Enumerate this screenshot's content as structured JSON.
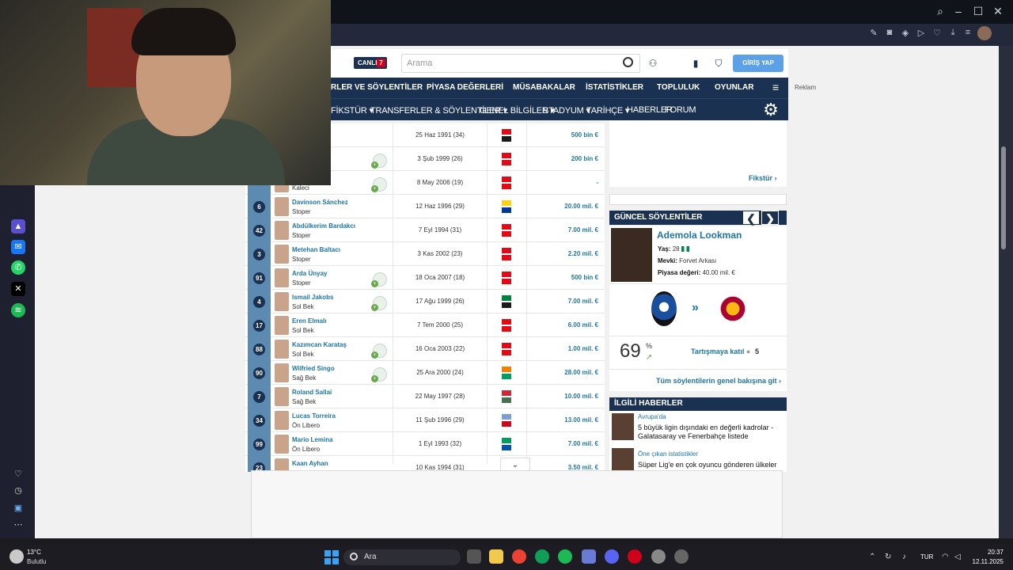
{
  "browser": {
    "window_controls": [
      "search",
      "minimize",
      "maximize",
      "close"
    ],
    "toolbar_icons": [
      "edit-icon",
      "camera-icon",
      "shield-check-icon",
      "play-icon",
      "heart-icon",
      "download-icon",
      "menu-icon"
    ]
  },
  "header": {
    "live_label": "CANLI",
    "live_count": "7",
    "search_placeholder": "Arama",
    "login_label": "GİRİŞ YAP",
    "ad_label": "Reklam"
  },
  "nav_main": [
    "RLER VE SÖYLENTİLER",
    "PİYASA DEĞERLERİ",
    "MÜSABAKALAR",
    "İSTATİSTİKLER",
    "TOPLULUK",
    "OYUNLAR"
  ],
  "nav_sub": [
    "FİKSTÜR ▾",
    "TRANSFERLER & SÖYLENTİLER ▾",
    "GENEL BİLGİLER ▾",
    "STADYUM ▾",
    "TARİHÇE ▾",
    "HABERLER",
    "FORUM"
  ],
  "players": [
    {
      "number": "",
      "name": "",
      "position": "",
      "dob": "25 Haz 1991 (34)",
      "value": "500 bin €",
      "flag": [
        "#e30a17",
        "#1a1a1a"
      ],
      "club": false
    },
    {
      "number": "",
      "name": "",
      "position": "",
      "dob": "3 Şub 1999 (26)",
      "value": "200 bin €",
      "flag": [
        "#e30a17",
        "#e30a17"
      ],
      "club": true
    },
    {
      "number": "",
      "name": "ük",
      "position": "Kaleci",
      "dob": "8 May 2006 (19)",
      "value": "-",
      "flag": [
        "#e30a17",
        "#e30a17"
      ],
      "club": true
    },
    {
      "number": "6",
      "name": "Davinson Sánchez",
      "position": "Stoper",
      "dob": "12 Haz 1996 (29)",
      "value": "20.00 mil. €",
      "flag": [
        "#fcd116",
        "#003893"
      ],
      "club": false
    },
    {
      "number": "42",
      "name": "Abdülkerim Bardakcı",
      "position": "Stoper",
      "dob": "7 Eyl 1994 (31)",
      "value": "7.00 mil. €",
      "flag": [
        "#e30a17",
        "#e30a17"
      ],
      "club": false
    },
    {
      "number": "3",
      "name": "Metehan Baltacı",
      "position": "Stoper",
      "dob": "3 Kas 2002 (23)",
      "value": "2.20 mil. €",
      "flag": [
        "#e30a17",
        "#e30a17"
      ],
      "club": false
    },
    {
      "number": "91",
      "name": "Arda Ünyay",
      "position": "Stoper",
      "dob": "18 Oca 2007 (18)",
      "value": "500 bin €",
      "flag": [
        "#e30a17",
        "#e30a17"
      ],
      "club": true
    },
    {
      "number": "4",
      "name": "Ismail Jakobs",
      "position": "Sol Bek",
      "dob": "17 Ağu 1999 (26)",
      "value": "7.00 mil. €",
      "flag": [
        "#00853f",
        "#1a1a1a"
      ],
      "club": true
    },
    {
      "number": "17",
      "name": "Eren Elmalı",
      "position": "Sol Bek",
      "dob": "7 Tem 2000 (25)",
      "value": "6.00 mil. €",
      "flag": [
        "#e30a17",
        "#e30a17"
      ],
      "club": false
    },
    {
      "number": "88",
      "name": "Kazımcan Karataş",
      "position": "Sol Bek",
      "dob": "16 Oca 2003 (22)",
      "value": "1.00 mil. €",
      "flag": [
        "#e30a17",
        "#e30a17"
      ],
      "club": true
    },
    {
      "number": "90",
      "name": "Wilfried Singo",
      "position": "Sağ Bek",
      "dob": "25 Ara 2000 (24)",
      "value": "28.00 mil. €",
      "flag": [
        "#f77f00",
        "#009e60"
      ],
      "club": true
    },
    {
      "number": "7",
      "name": "Roland Sallai",
      "position": "Sağ Bek",
      "dob": "22 May 1997 (28)",
      "value": "10.00 mil. €",
      "flag": [
        "#ce2939",
        "#477050"
      ],
      "club": false
    },
    {
      "number": "34",
      "name": "Lucas Torreira",
      "position": "Ön Libero",
      "dob": "11 Şub 1996 (29)",
      "value": "13.00 mil. €",
      "flag": [
        "#7b9fd4",
        "#c60b1e"
      ],
      "club": false
    },
    {
      "number": "99",
      "name": "Mario Lemina",
      "position": "Ön Libero",
      "dob": "1 Eyl 1993 (32)",
      "value": "7.00 mil. €",
      "flag": [
        "#009e60",
        "#0055a4"
      ],
      "club": false
    },
    {
      "number": "23",
      "name": "Kaan Ayhan",
      "position": "",
      "dob": "10 Kas 1994 (31)",
      "value": "3.50 mil. €",
      "flag": [
        "#e30a17",
        "#e30a17"
      ],
      "club": false
    }
  ],
  "fixture_link": "Fikstür",
  "rumors": {
    "heading": "GÜNCEL SÖYLENTİLER",
    "prev": "❮",
    "next": "❯",
    "player_name": "Ademola Lookman",
    "age_label": "Yaş:",
    "age": "28",
    "position_label": "Mevki:",
    "position": "Forvet Arkası",
    "value_label": "Piyasa değeri:",
    "value": "40.00 mil. €",
    "probability": "69",
    "probability_unit": "%",
    "discuss_label": "Tartışmaya katıl",
    "comment_count": "5",
    "all_label": "Tüm söylentilerin genel bakışına git"
  },
  "news": {
    "heading": "İLGİLİ HABERLER",
    "items": [
      {
        "category": "Avrupa'da",
        "title": "5 büyük ligin dışındaki en değerli kadrolar - Galatasaray ve Fenerbahçe listede"
      },
      {
        "category": "Öne çıkan istatistikler",
        "title": "Süper Lig'e en çok oyuncu gönderen ülkeler - Lig"
      }
    ]
  },
  "taskbar": {
    "temperature": "13°C",
    "condition": "Bulutlu",
    "search_label": "Ara",
    "language": "TUR",
    "time": "20:37",
    "date": "12.11.2025"
  },
  "colors": {
    "primary_navy": "#1a3151",
    "link_blue": "#1d75a3",
    "number_column": "#5d8ab0",
    "login_button": "#5ca1e6"
  }
}
